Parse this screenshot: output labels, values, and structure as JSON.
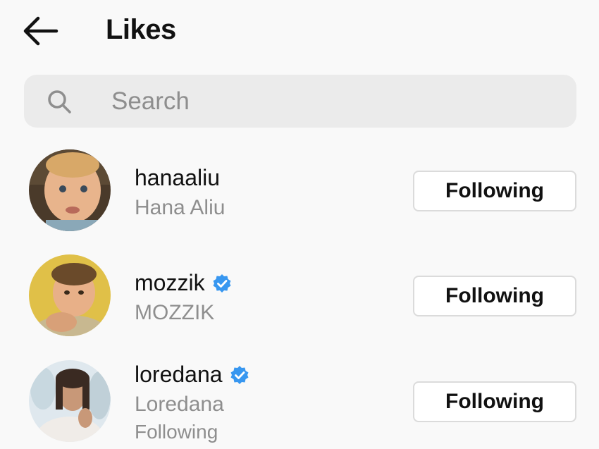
{
  "header": {
    "title": "Likes",
    "back_icon": "arrow-left-icon"
  },
  "search": {
    "placeholder": "Search",
    "value": "",
    "icon": "search-icon"
  },
  "users": [
    {
      "username": "hanaaliu",
      "full_name": "Hana Aliu",
      "verified": false,
      "extra": "",
      "button_label": "Following"
    },
    {
      "username": "mozzik",
      "full_name": "MOZZIK",
      "verified": true,
      "extra": "",
      "button_label": "Following"
    },
    {
      "username": "loredana",
      "full_name": "Loredana",
      "verified": true,
      "extra": "Following",
      "button_label": "Following"
    }
  ],
  "colors": {
    "background": "#f9f9f9",
    "search_bg": "#ebebeb",
    "secondary_text": "#8e8e8e",
    "verified_blue": "#3897f0",
    "button_border": "#dbdbdb"
  }
}
